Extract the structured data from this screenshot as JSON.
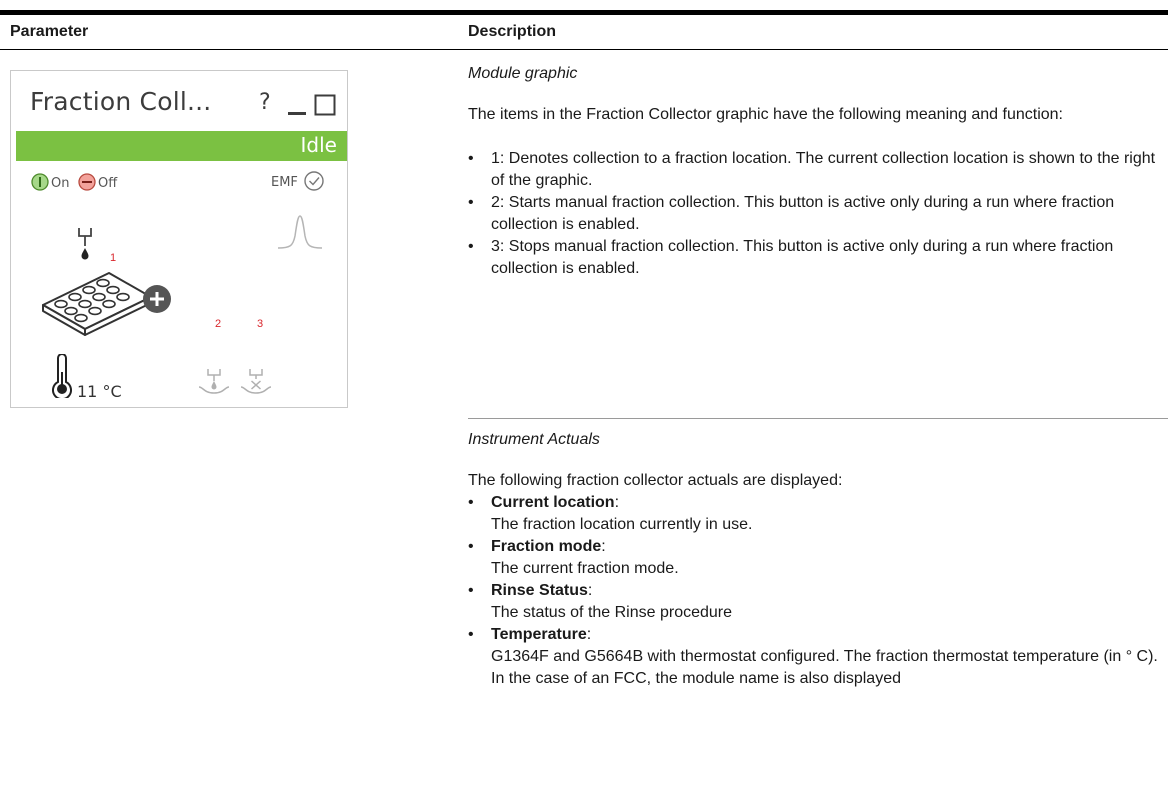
{
  "table": {
    "header_parameter": "Parameter",
    "header_description": "Description"
  },
  "widget": {
    "title": "Fraction Coll...",
    "help": "?",
    "status": "Idle",
    "on_label": "On",
    "off_label": "Off",
    "emf_label": "EMF",
    "marker_1": "1",
    "marker_2": "2",
    "marker_3": "3",
    "temperature": "11 °C",
    "colors": {
      "status_green": "#7bc142",
      "on_green": "#7bc142",
      "off_red": "#e8736f",
      "marker_red": "#d9262c"
    }
  },
  "section_graphic": {
    "title": "Module graphic",
    "intro": "The items in the Fraction Collector graphic have the following meaning and function:",
    "items": [
      "1: Denotes collection to a fraction location. The current collection location is shown to the right of the graphic.",
      "2: Starts manual fraction collection. This button is active only during a run where fraction collection is enabled.",
      "3: Stops manual fraction collection. This button is active only during a run where fraction collection is enabled."
    ]
  },
  "section_actuals": {
    "title": "Instrument Actuals",
    "intro": "The following fraction collector actuals are displayed:",
    "items": [
      {
        "term": "Current location",
        "desc": "The fraction location currently in use."
      },
      {
        "term": "Fraction mode",
        "desc": "The current fraction mode."
      },
      {
        "term": "Rinse Status",
        "desc": "The status of the Rinse procedure"
      },
      {
        "term": "Temperature",
        "desc": "G1364F and G5664B with thermostat configured. The fraction thermostat temperature (in ° C). In the case of an FCC, the module name is also displayed"
      }
    ]
  }
}
